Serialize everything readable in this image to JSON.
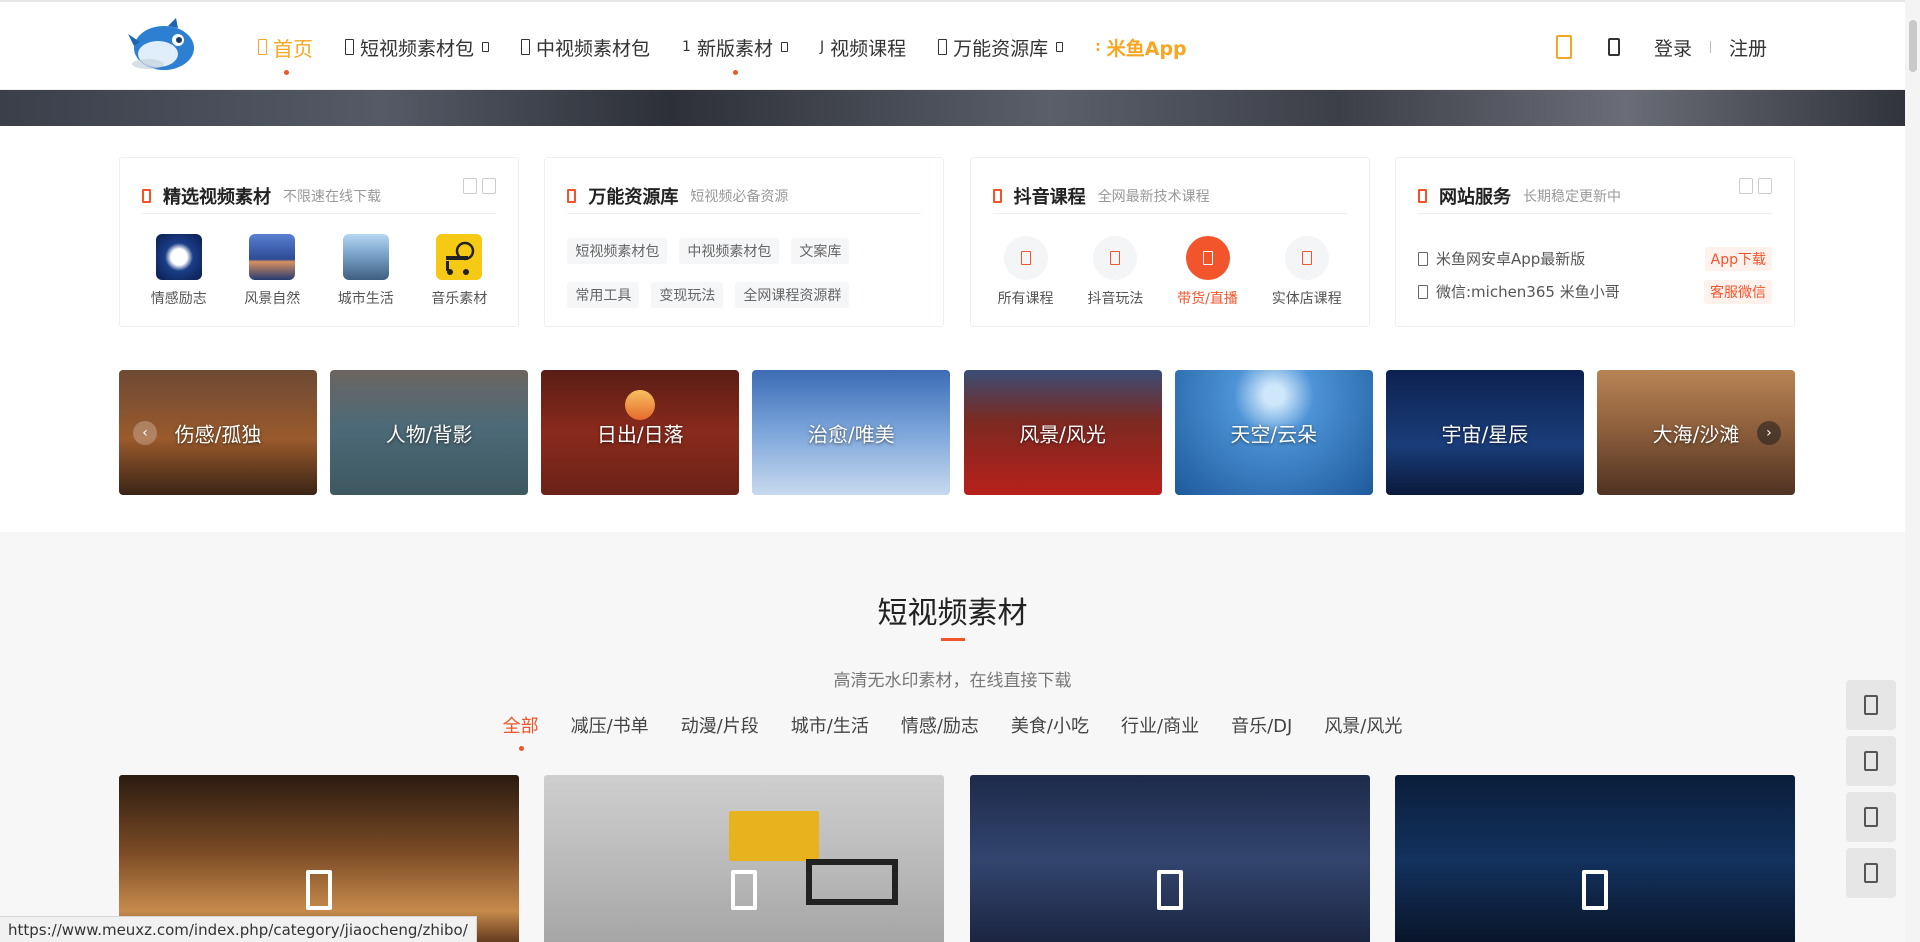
{
  "nav": {
    "items": [
      {
        "label": "首页",
        "active": true
      },
      {
        "label": "短视频素材包",
        "caret": true
      },
      {
        "label": "中视频素材包"
      },
      {
        "label": "新版素材",
        "caret": true,
        "dot": true,
        "prefix": "1"
      },
      {
        "label": "视频课程",
        "prefix": "J"
      },
      {
        "label": "万能资源库",
        "caret": true
      },
      {
        "label": "米鱼App",
        "app": true,
        "prefix": ":"
      }
    ],
    "login": "登录",
    "register": "注册",
    "accent_color": "#f5a623"
  },
  "cards": {
    "featured": {
      "title": "精选视频素材",
      "subtitle": "不限速在线下载",
      "items": [
        {
          "label": "情感励志"
        },
        {
          "label": "风景自然"
        },
        {
          "label": "城市生活"
        },
        {
          "label": "音乐素材"
        }
      ]
    },
    "library": {
      "title": "万能资源库",
      "subtitle": "短视频必备资源",
      "tags": [
        "短视频素材包",
        "中视频素材包",
        "文案库",
        "常用工具",
        "变现玩法",
        "全网课程资源群"
      ]
    },
    "douyin": {
      "title": "抖音课程",
      "subtitle": "全网最新技术课程",
      "items": [
        {
          "label": "所有课程"
        },
        {
          "label": "抖音玩法"
        },
        {
          "label": "带货/直播",
          "active": true
        },
        {
          "label": "实体店课程"
        }
      ]
    },
    "service": {
      "title": "网站服务",
      "subtitle": "长期稳定更新中",
      "rows": [
        {
          "text": "米鱼网安卓App最新版",
          "button": "App下载"
        },
        {
          "text": "微信:michen365 米鱼小哥",
          "button": "客服微信"
        }
      ]
    }
  },
  "categories": [
    "伤感/孤独",
    "人物/背影",
    "日出/日落",
    "治愈/唯美",
    "风景/风光",
    "天空/云朵",
    "宇宙/星辰",
    "大海/沙滩"
  ],
  "section": {
    "title": "短视频素材",
    "subtitle": "高清无水印素材，在线直接下载",
    "filters": [
      "全部",
      "减压/书单",
      "动漫/片段",
      "城市/生活",
      "情感/励志",
      "美食/小吃",
      "行业/商业",
      "音乐/DJ",
      "风景/风光"
    ],
    "active_filter": "全部",
    "accent_color": "#f2552c"
  },
  "status_url": "https://www.meuxz.com/index.php/category/jiaocheng/zhibo/"
}
